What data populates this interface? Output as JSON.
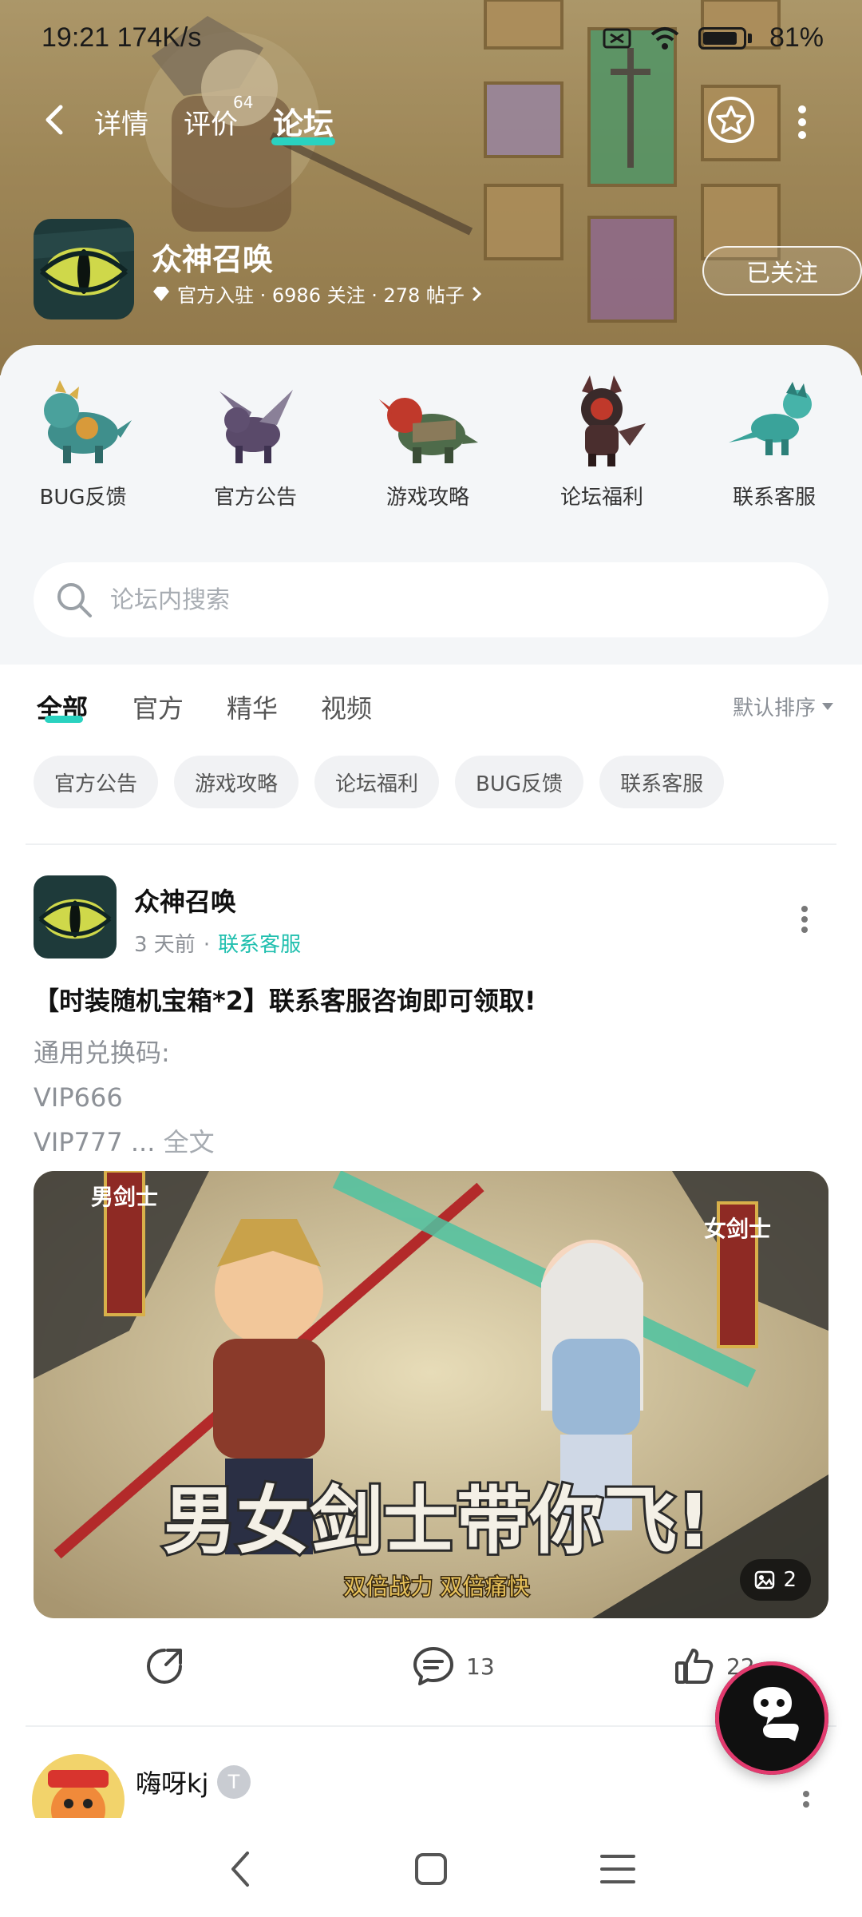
{
  "status_bar": {
    "time_speed": "19:21 174K/s",
    "battery": "81%"
  },
  "nav": {
    "tabs": [
      {
        "label": "详情"
      },
      {
        "label": "评价",
        "badge": "64"
      },
      {
        "label": "论坛"
      }
    ]
  },
  "game": {
    "name": "众神召唤",
    "meta": "官方入驻 · 6986 关注 · 278 帖子",
    "follow_label": "已关注"
  },
  "categories": [
    {
      "label": "BUG反馈",
      "color": "#3f8f8c"
    },
    {
      "label": "官方公告",
      "color": "#5a4a6a"
    },
    {
      "label": "游戏攻略",
      "color": "#c0392b"
    },
    {
      "label": "论坛福利",
      "color": "#3a2a2a"
    },
    {
      "label": "联系客服",
      "color": "#3aa39a"
    }
  ],
  "search": {
    "placeholder": "论坛内搜索"
  },
  "filter_tabs": [
    {
      "label": "全部"
    },
    {
      "label": "官方"
    },
    {
      "label": "精华"
    },
    {
      "label": "视频"
    }
  ],
  "sort_label": "默认排序",
  "chips": [
    "官方公告",
    "游戏攻略",
    "论坛福利",
    "BUG反馈",
    "联系客服"
  ],
  "post": {
    "author": "众神召唤",
    "time": "3 天前",
    "tag": "联系客服",
    "title": "【时装随机宝箱*2】联系客服咨询即可领取!",
    "body_lines": [
      "通用兑换码:",
      "VIP666",
      "VIP777"
    ],
    "ellipsis": "...",
    "fulltext": "全文",
    "image": {
      "left_sign": "男剑士",
      "right_sign": "女剑士",
      "headline": "男女剑士带你飞!",
      "subline": "双倍战力 双倍痛快",
      "count": "2"
    },
    "comments": "13",
    "likes": "22"
  },
  "post2": {
    "author": "嗨呀kj",
    "badge": "T"
  },
  "colors": {
    "accent": "#2ad2c0",
    "tag": "#1fbfae"
  }
}
